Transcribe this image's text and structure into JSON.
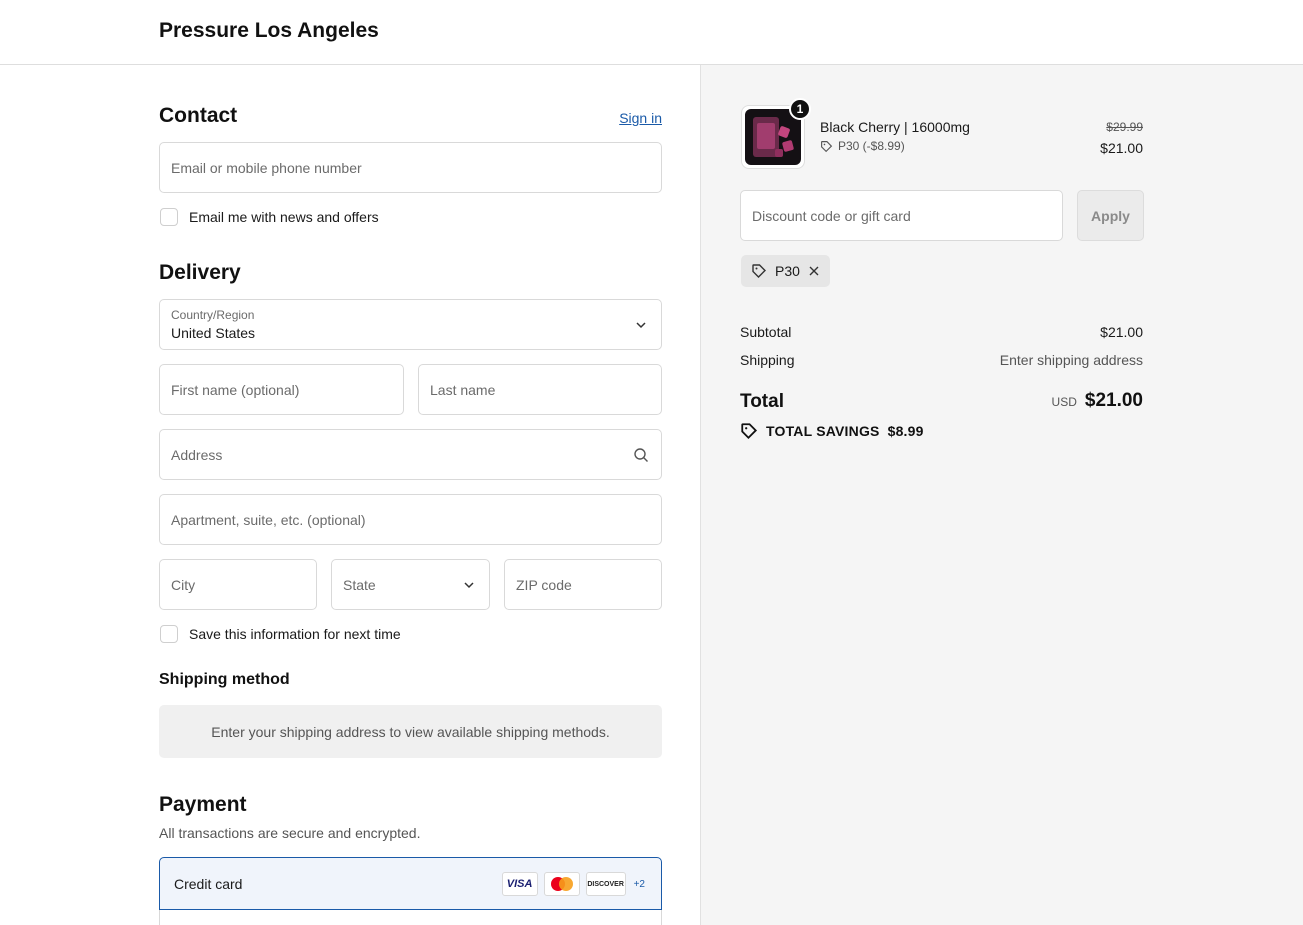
{
  "header": {
    "store_name": "Pressure Los Angeles"
  },
  "contact": {
    "title": "Contact",
    "sign_in": "Sign in",
    "email_placeholder": "Email or mobile phone number",
    "newsletter_label": "Email me with news and offers"
  },
  "delivery": {
    "title": "Delivery",
    "country_label": "Country/Region",
    "country_value": "United States",
    "first_name_placeholder": "First name (optional)",
    "last_name_placeholder": "Last name",
    "address_placeholder": "Address",
    "apartment_placeholder": "Apartment, suite, etc. (optional)",
    "city_placeholder": "City",
    "state_placeholder": "State",
    "zip_placeholder": "ZIP code",
    "save_info_label": "Save this information for next time"
  },
  "shipping_method": {
    "title": "Shipping method",
    "message": "Enter your shipping address to view available shipping methods."
  },
  "payment": {
    "title": "Payment",
    "subtitle": "All transactions are secure and encrypted.",
    "selected_method": "Credit card",
    "card_logos": [
      "VISA",
      "mastercard",
      "DISCOVER"
    ],
    "more_cards": "+2"
  },
  "order_summary": {
    "item": {
      "name": "Black Cherry | 16000mg",
      "quantity": "1",
      "discount": "P30 (-$8.99)",
      "original_price": "$29.99",
      "price": "$21.00"
    },
    "discount_placeholder": "Discount code or gift card",
    "apply_label": "Apply",
    "applied_code": "P30",
    "subtotal_label": "Subtotal",
    "subtotal_value": "$21.00",
    "shipping_label": "Shipping",
    "shipping_value": "Enter shipping address",
    "total_label": "Total",
    "currency": "USD",
    "total_value": "$21.00",
    "savings_label": "TOTAL SAVINGS",
    "savings_value": "$8.99"
  },
  "colors": {
    "accent": "#1a5aa8",
    "summary_bg": "#f5f5f5"
  },
  "icons": [
    "chevron-down-icon",
    "search-icon",
    "tag-icon",
    "close-icon"
  ]
}
